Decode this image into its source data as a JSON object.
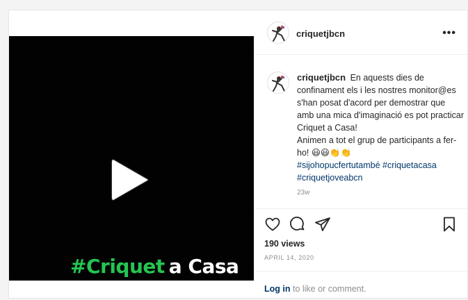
{
  "post": {
    "username": "criquetjbcn",
    "more_label": "•••",
    "video_overlay": {
      "green_text": "#Criquet",
      "white_text": "a Casa"
    },
    "caption": {
      "username": "criquetjbcn",
      "line_1": "En aquests dies de confinament els i les nostres monitor@es s'han posat d'acord per demostrar que amb una mica d'imaginació es pot practicar Criquet a Casa!",
      "line_2": "Animen a tot el grup de participants a fer-ho! 😃😃👏👏",
      "hashtags": [
        "#sijohopucfertutambé",
        "#criquetacasa",
        "#criquetjoveabcn"
      ],
      "time_ago": "23w"
    },
    "views": "190 views",
    "date": "APRIL 14, 2020",
    "login": {
      "link": "Log in",
      "rest": "to like or comment."
    }
  },
  "icons": [
    "play-icon",
    "user-tag-icon",
    "heart-icon",
    "comment-icon",
    "share-icon",
    "bookmark-icon",
    "more-icon"
  ]
}
